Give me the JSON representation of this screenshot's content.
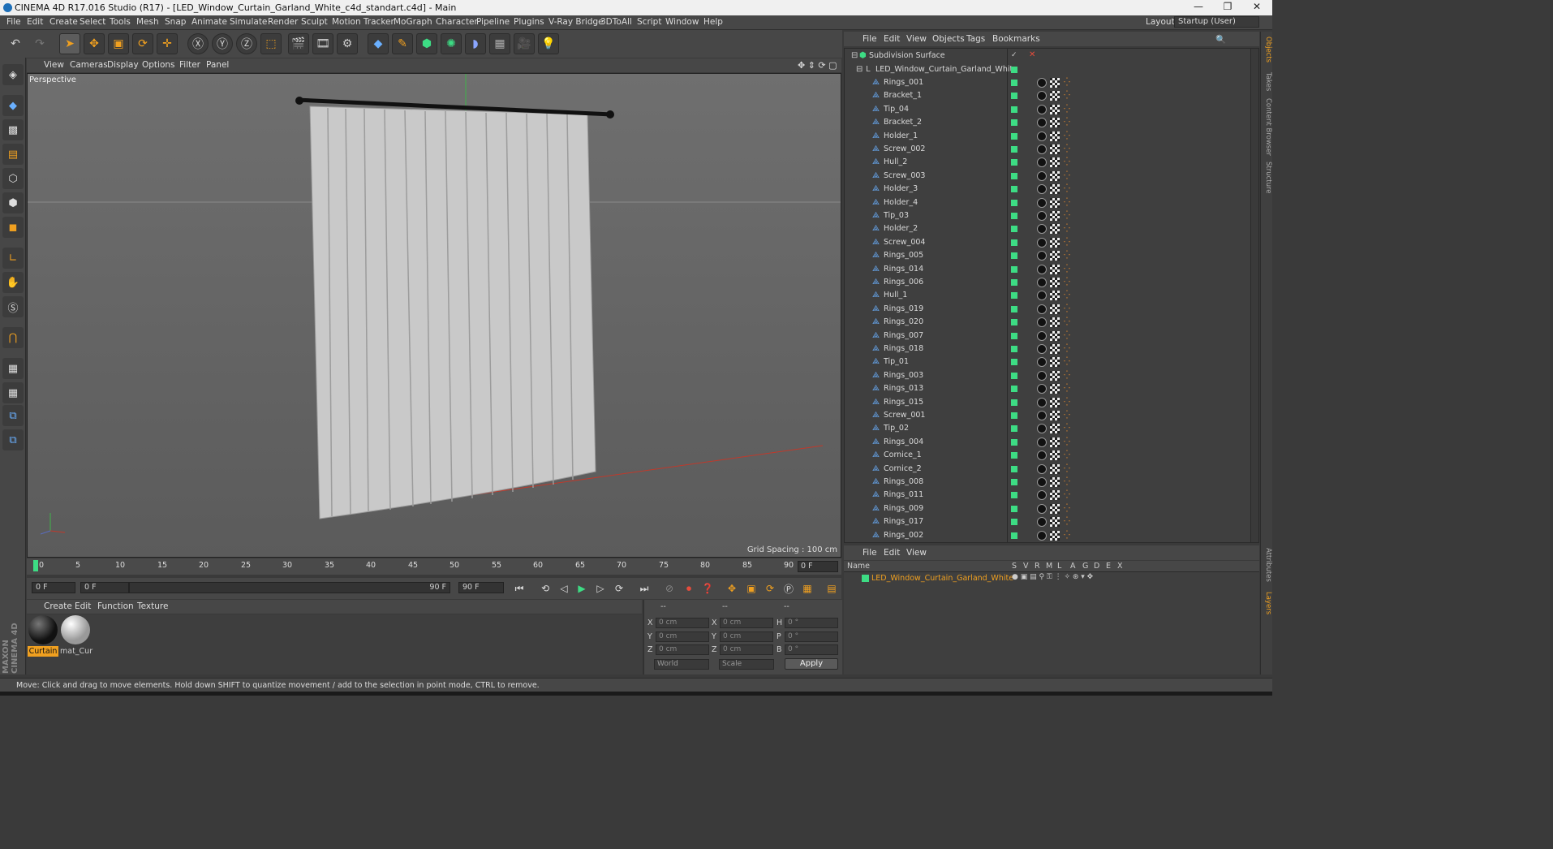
{
  "window": {
    "title": "CINEMA 4D R17.016 Studio (R17) - [LED_Window_Curtain_Garland_White_c4d_standart.c4d] - Main",
    "minimize": "—",
    "restore": "❐",
    "close": "✕"
  },
  "menubar": {
    "items": [
      "File",
      "Edit",
      "Create",
      "Select",
      "Tools",
      "Mesh",
      "Snap",
      "Animate",
      "Simulate",
      "Render",
      "Sculpt",
      "Motion Tracker",
      "MoGraph",
      "Character",
      "Pipeline",
      "Plugins",
      "V-Ray Bridge",
      "3DToAll",
      "Script",
      "Window",
      "Help"
    ],
    "layout_label": "Layout:",
    "layout_value": "Startup (User)"
  },
  "viewport": {
    "menu": [
      "View",
      "Cameras",
      "Display",
      "Options",
      "Filter",
      "Panel"
    ],
    "label": "Perspective",
    "grid_spacing": "Grid Spacing : 100 cm"
  },
  "timeline": {
    "ticks": [
      "0",
      "5",
      "10",
      "15",
      "20",
      "25",
      "30",
      "35",
      "40",
      "45",
      "50",
      "55",
      "60",
      "65",
      "70",
      "75",
      "80",
      "85",
      "90"
    ],
    "current_frame": "0 F",
    "start_field": "0 F",
    "range_start": "0 F",
    "range_end": "90 F",
    "end_field": "90 F"
  },
  "materials": {
    "menu": [
      "Create",
      "Edit",
      "Function",
      "Texture"
    ],
    "items": [
      {
        "name": "Curtain"
      },
      {
        "name": "mat_Cur"
      }
    ]
  },
  "coords": {
    "headers": [
      "--",
      "--",
      "--"
    ],
    "rows": [
      {
        "a": "X",
        "av": "0 cm",
        "b": "X",
        "bv": "0 cm",
        "c": "H",
        "cv": "0 °"
      },
      {
        "a": "Y",
        "av": "0 cm",
        "b": "Y",
        "bv": "0 cm",
        "c": "P",
        "cv": "0 °"
      },
      {
        "a": "Z",
        "av": "0 cm",
        "b": "Z",
        "bv": "0 cm",
        "c": "B",
        "cv": "0 °"
      }
    ],
    "world": "World",
    "scale": "Scale",
    "apply": "Apply"
  },
  "status": "Move: Click and drag to move elements. Hold down SHIFT to quantize movement / add to the selection in point mode, CTRL to remove.",
  "object_manager": {
    "menu": [
      "File",
      "Edit",
      "View",
      "Objects",
      "Tags",
      "Bookmarks"
    ],
    "root": "Subdivision Surface",
    "group": "LED_Window_Curtain_Garland_White",
    "children": [
      "Rings_001",
      "Bracket_1",
      "Tip_04",
      "Bracket_2",
      "Holder_1",
      "Screw_002",
      "Hull_2",
      "Screw_003",
      "Holder_3",
      "Holder_4",
      "Tip_03",
      "Holder_2",
      "Screw_004",
      "Rings_005",
      "Rings_014",
      "Rings_006",
      "Hull_1",
      "Rings_019",
      "Rings_020",
      "Rings_007",
      "Rings_018",
      "Tip_01",
      "Rings_003",
      "Rings_013",
      "Rings_015",
      "Screw_001",
      "Tip_02",
      "Rings_004",
      "Cornice_1",
      "Cornice_2",
      "Rings_008",
      "Rings_011",
      "Rings_009",
      "Rings_017",
      "Rings_002"
    ]
  },
  "layers": {
    "menu": [
      "File",
      "Edit",
      "View"
    ],
    "columns": [
      "Name",
      "S",
      "V",
      "R",
      "M",
      "L",
      "A",
      "G",
      "D",
      "E",
      "X"
    ],
    "layer_name": "LED_Window_Curtain_Garland_White"
  },
  "side_tabs": [
    "Objects",
    "Takes",
    "Content Browser",
    "Structure",
    "Attributes",
    "Layers"
  ],
  "brand": "MAXON CINEMA 4D",
  "colors": {
    "accent_orange": "#f0a020",
    "layer_green": "#3ddc84",
    "selection_orange": "#e88b2d"
  }
}
